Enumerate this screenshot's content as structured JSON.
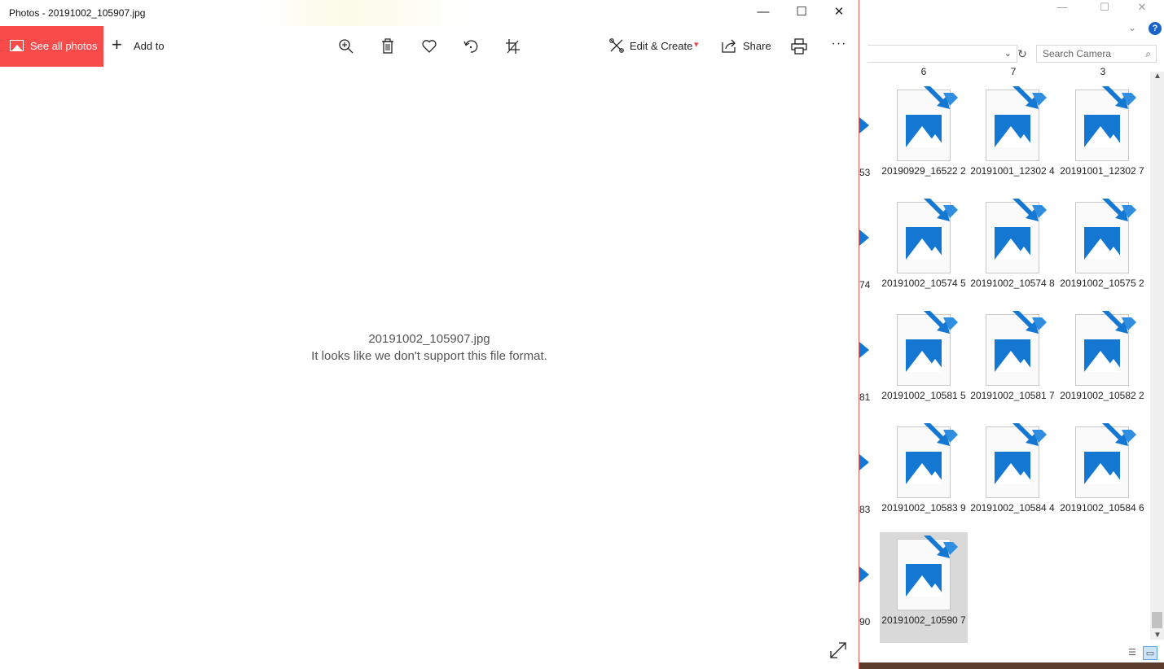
{
  "photos": {
    "window_title": "Photos - 20191002_105907.jpg",
    "window_controls": {
      "minimize": "—",
      "maximize": "☐",
      "close": "✕"
    },
    "toolbar": {
      "see_all_label": "See all photos",
      "add_to_label": "Add to",
      "edit_create_label": "Edit & Create",
      "share_label": "Share",
      "more_label": "···"
    },
    "message": {
      "filename": "20191002_105907.jpg",
      "error": "It looks like we don't support this file format."
    },
    "accent_color": "#fa4b4b"
  },
  "explorer": {
    "window_controls": {
      "minimize": "—",
      "maximize": "☐",
      "close": "✕"
    },
    "search_placeholder": "Search Camera",
    "help_label": "?",
    "partial_top_labels": [
      "6",
      "7",
      "3"
    ],
    "partial_left_labels": [
      "53",
      "74",
      "81",
      "83",
      "90"
    ],
    "files": [
      "20190929_165222",
      "20191001_123024",
      "20191001_123027",
      "20191002_105745",
      "20191002_105748",
      "20191002_105752",
      "20191002_105815",
      "20191002_105817",
      "20191002_105822",
      "20191002_105839",
      "20191002_105844",
      "20191002_105846",
      "20191002_105907"
    ],
    "selected_file": "20191002_105907",
    "icon_color": "#1478d3"
  }
}
